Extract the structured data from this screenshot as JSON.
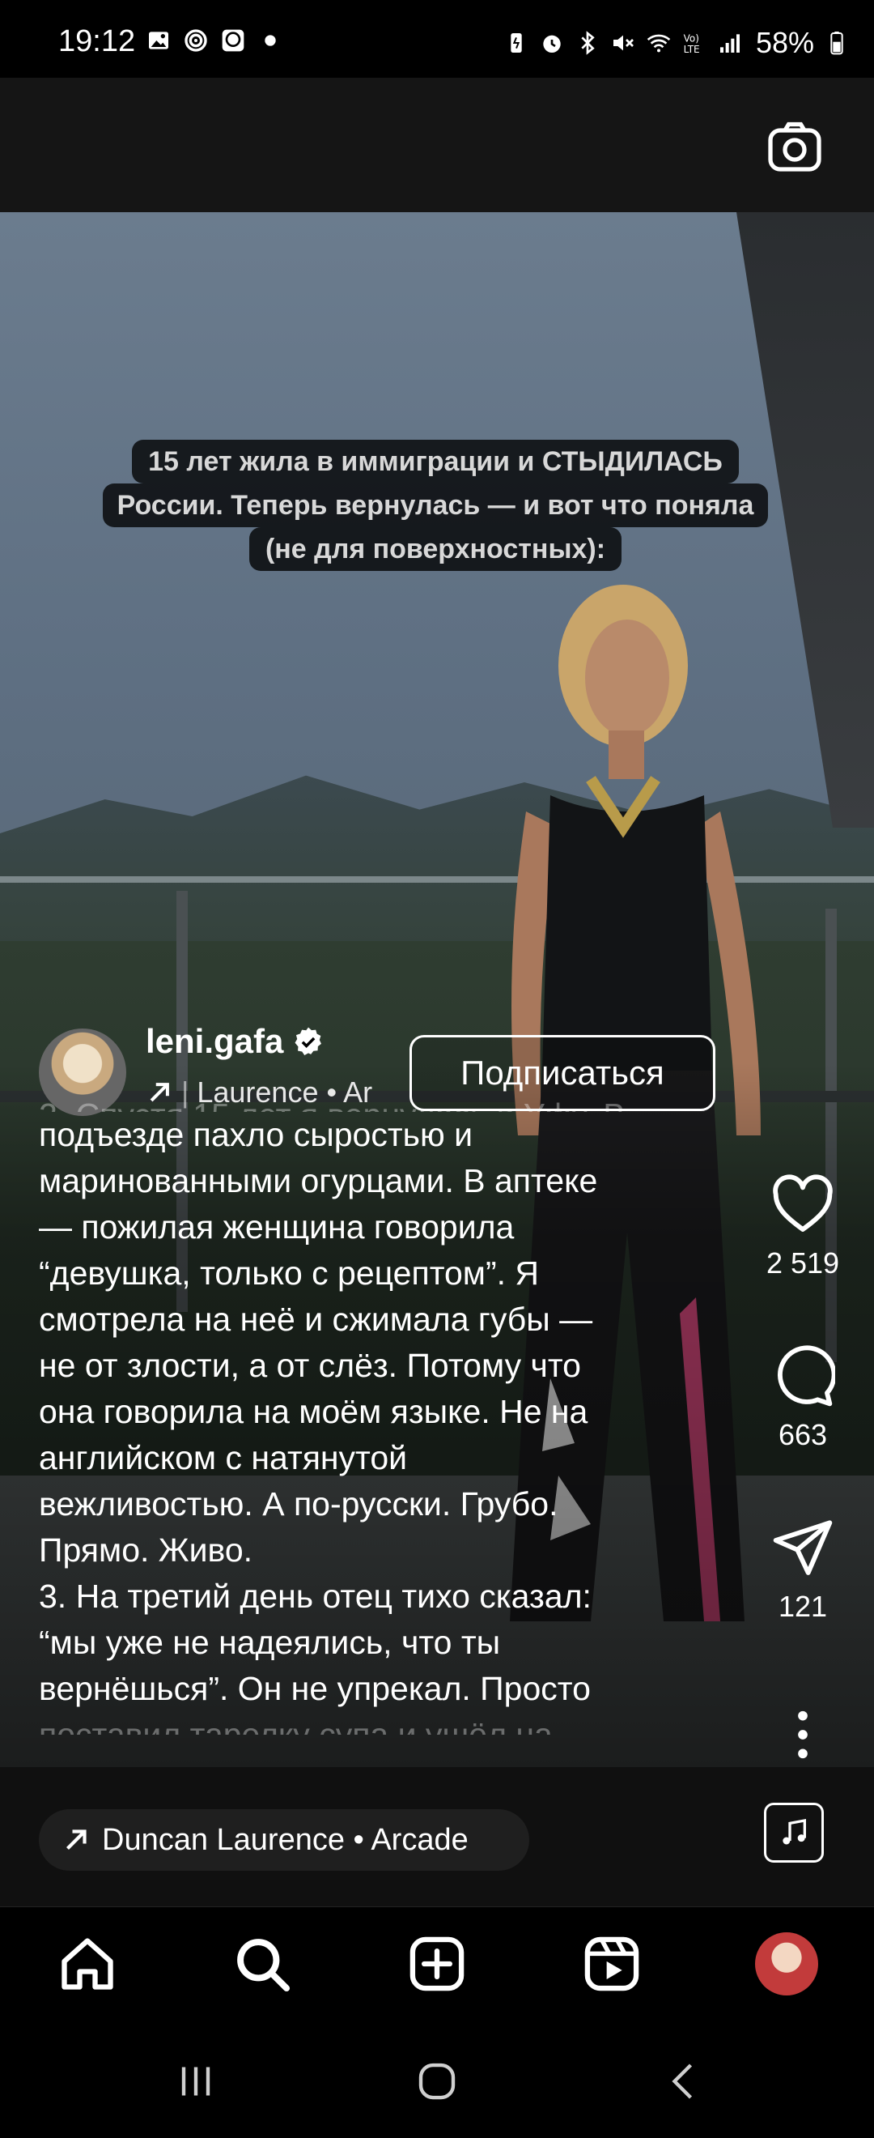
{
  "status_bar": {
    "time": "19:12",
    "battery": "58%",
    "left_icons": [
      "gallery-icon",
      "swirl-icon",
      "chat-bubble-icon",
      "dot-icon"
    ],
    "right_icons": [
      "battery-saver-icon",
      "alarm-icon",
      "bluetooth-icon",
      "mute-icon",
      "wifi-icon",
      "volte-icon",
      "signal-icon",
      "battery-icon"
    ]
  },
  "header": {
    "camera_icon": "camera-icon"
  },
  "reel": {
    "overlay_lines": [
      "15 лет жила в иммиграции и СТЫДИЛАСЬ",
      "России. Теперь вернулась — и вот что поняла",
      "(не для поверхностных):"
    ],
    "author": {
      "username": "leni.gafa",
      "verified": true,
      "audio_snippet": "Laurence • Ar",
      "follow_label": "Подписаться"
    },
    "caption": {
      "faded_top": "2. Спустя 15 лет я вернулась в Уфу. В",
      "lines": [
        "подъезде пахло сыростью и",
        "маринованными огурцами. В аптеке",
        "— пожилая женщина говорила",
        "“девушка, только с рецептом”. Я",
        "смотрела на неё и сжимала губы —",
        "не от злости, а от слёз. Потому что",
        "она говорила на моём языке. Не на",
        "английском с натянутой",
        "вежливостью. А по-русски. Грубо.",
        "Прямо. Живо.",
        "3. На третий день отец тихо сказал:",
        "“мы уже не надеялись, что ты",
        "вернёшься”. Он не упрекал. Просто"
      ],
      "faded_bottom": "поставил тарелку супа и ушёл на"
    },
    "actions": {
      "likes": "2 519",
      "comments": "663",
      "shares": "121"
    }
  },
  "audio": {
    "track": "Duncan Laurence • Arcade"
  },
  "nav": {
    "items": [
      "home",
      "search",
      "create",
      "reels",
      "profile"
    ]
  }
}
